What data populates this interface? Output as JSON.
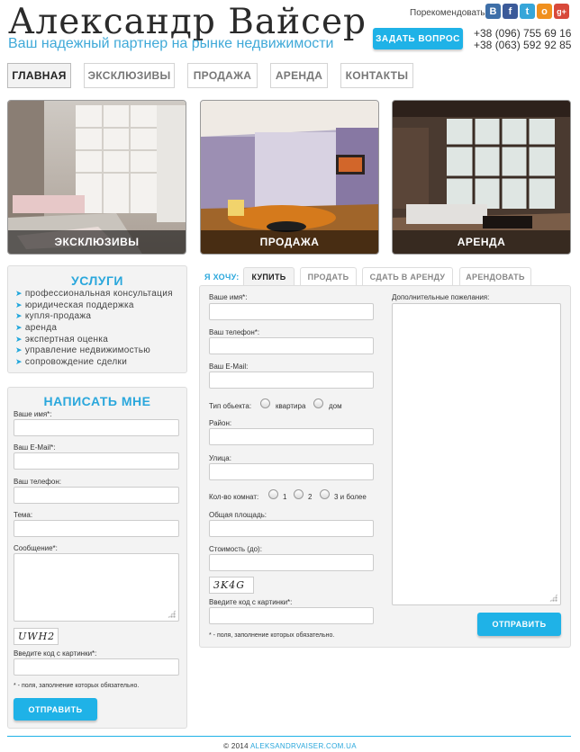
{
  "header": {
    "title": "Александр Вайсер",
    "subtitle": "Ваш надежный партнер на рынке недвижимости",
    "recommend_label": "Порекомендовать:",
    "social": [
      {
        "icon": "vk-icon",
        "glyph": "B",
        "color": "#3e6fa8"
      },
      {
        "icon": "facebook-icon",
        "glyph": "f",
        "color": "#3b5a99"
      },
      {
        "icon": "twitter-icon",
        "glyph": "t",
        "color": "#36a6d9"
      },
      {
        "icon": "odnoklassniki-icon",
        "glyph": "o",
        "color": "#f0901e"
      },
      {
        "icon": "google-plus-icon",
        "glyph": "g+",
        "color": "#d8493a"
      }
    ],
    "ask_button": "ЗАДАТЬ ВОПРОС",
    "phone1": "+38 (096) 755 69 16",
    "phone2": "+38 (063) 592 92 85"
  },
  "nav": [
    {
      "label": "ГЛАВНАЯ",
      "active": true
    },
    {
      "label": "ЭКСКЛЮЗИВЫ",
      "active": false
    },
    {
      "label": "ПРОДАЖА",
      "active": false
    },
    {
      "label": "АРЕНДА",
      "active": false
    },
    {
      "label": "КОНТАКТЫ",
      "active": false
    }
  ],
  "tiles": [
    {
      "caption": "ЭКСКЛЮЗИВЫ"
    },
    {
      "caption": "ПРОДАЖА"
    },
    {
      "caption": "АРЕНДА"
    }
  ],
  "services": {
    "title": "УСЛУГИ",
    "items": [
      "профессиональная консультация",
      "юридическая поддержка",
      "купля-продажа",
      "аренда",
      "экспертная оценка",
      "управление недвижимостью",
      "сопровождение сделки"
    ]
  },
  "contact_form": {
    "title": "НАПИСАТЬ МНЕ",
    "name_label": "Ваше имя*:",
    "email_label": "Ваш E-Mail*:",
    "phone_label": "Ваш телефон:",
    "subject_label": "Тема:",
    "message_label": "Сообщение*:",
    "captcha_text": "UWH2",
    "captcha_label": "Введите код с картинки*:",
    "note": "* - поля, заполнение которых обязательно.",
    "submit": "ОТПРАВИТЬ"
  },
  "request_form": {
    "lead": "Я ХОЧУ:",
    "tabs": [
      {
        "label": "КУПИТЬ",
        "active": true
      },
      {
        "label": "ПРОДАТЬ",
        "active": false
      },
      {
        "label": "СДАТЬ В АРЕНДУ",
        "active": false
      },
      {
        "label": "АРЕНДОВАТЬ",
        "active": false
      }
    ],
    "name_label": "Ваше имя*:",
    "phone_label": "Ваш телефон*:",
    "email_label": "Ваш E-Mail:",
    "object_type_label": "Тип обьекта:",
    "object_types": [
      "квартира",
      "дом"
    ],
    "district_label": "Район:",
    "street_label": "Улица:",
    "rooms_label": "Кол-во комнат:",
    "rooms": [
      "1",
      "2",
      "3 и более"
    ],
    "area_label": "Общая площадь:",
    "price_label": "Стоимость (до):",
    "captcha_text": "3K4G",
    "captcha_label": "Введите код с картинки*:",
    "note": "* - поля, заполнение которых обязательно.",
    "wishes_label": "Дополнительные пожелания:",
    "submit": "ОТПРАВИТЬ"
  },
  "footer": {
    "copyright": "© 2014",
    "link": "ALEKSANDRVAISER.COM.UA"
  }
}
